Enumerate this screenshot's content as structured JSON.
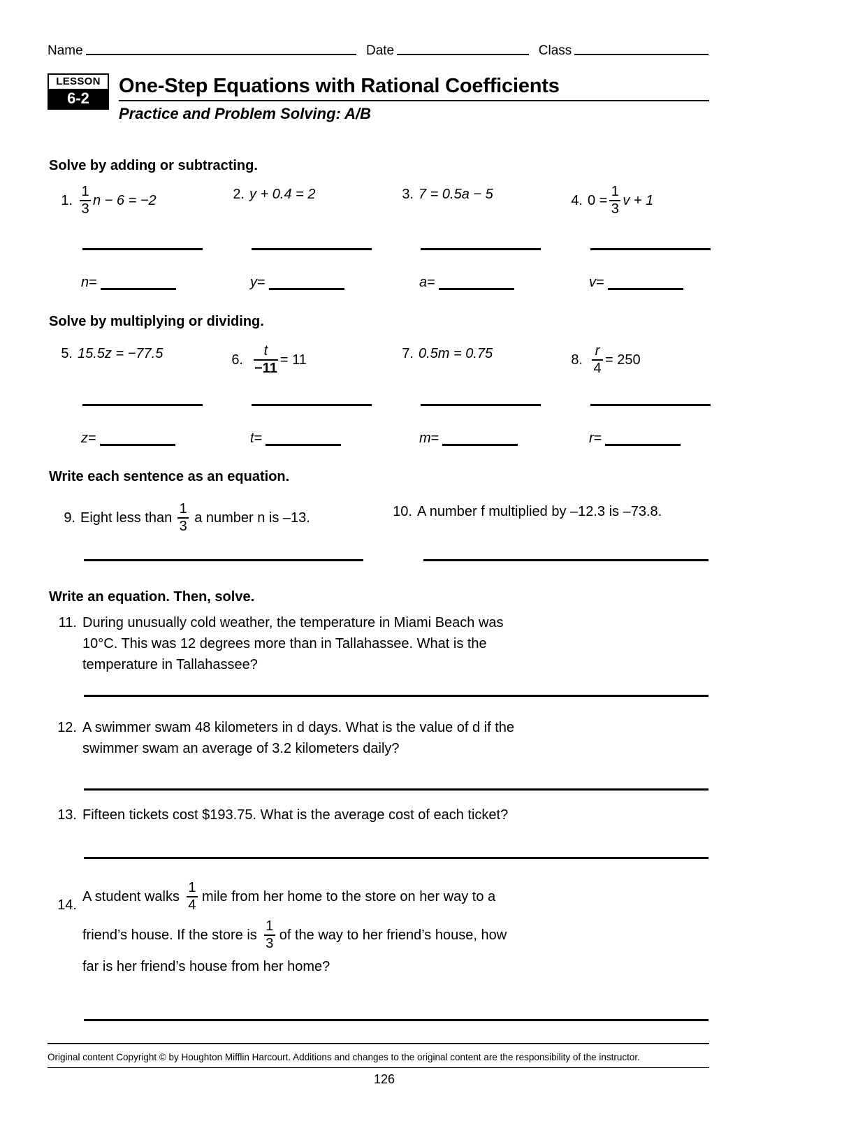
{
  "header": {
    "name_label": "Name",
    "date_label": "Date",
    "class_label": "Class"
  },
  "lesson_badge": {
    "word": "LESSON",
    "number": "6-2"
  },
  "title": "One-Step Equations with Rational Coefficients",
  "subtitle": "Practice and Problem Solving: A/B",
  "sections": {
    "add_subtract": "Solve by adding or subtracting.",
    "multiply_divide": "Solve by multiplying or dividing.",
    "write_sentence": "Write each sentence as an equation.",
    "write_solve": "Write an equation. Then, solve."
  },
  "problems_1_4": [
    {
      "number": "1.",
      "type": "fraction_lead",
      "frac": {
        "num": "1",
        "den": "3"
      },
      "after": "n − 6 = −2",
      "answer_var": "n",
      "equals": "="
    },
    {
      "number": "2.",
      "type": "plain",
      "text": "y + 0.4 = 2",
      "answer_var": "y",
      "equals": "="
    },
    {
      "number": "3.",
      "type": "plain",
      "text": "7 = 0.5a − 5",
      "answer_var": "a",
      "equals": "="
    },
    {
      "number": "4.",
      "type": "fraction_mid",
      "before": "0 =",
      "frac": {
        "num": "1",
        "den": "3"
      },
      "after": "v + 1",
      "answer_var": "v",
      "equals": "="
    }
  ],
  "problems_5_8": [
    {
      "number": "5.",
      "type": "plain",
      "text": "15.5z = −77.5",
      "answer_var": "z",
      "equals": "="
    },
    {
      "number": "6.",
      "type": "fraction_lead",
      "frac": {
        "num": "t",
        "den": "−11"
      },
      "after": "= 11",
      "answer_var": "t",
      "equals": "="
    },
    {
      "number": "7.",
      "type": "plain",
      "text": "0.5m = 0.75",
      "answer_var": "m",
      "equals": "="
    },
    {
      "number": "8.",
      "type": "fraction_lead",
      "frac": {
        "num": "r",
        "den": "4"
      },
      "after": "= 250",
      "answer_var": "r",
      "equals": "="
    }
  ],
  "problems_9_10": [
    {
      "number": "9.",
      "part1": "Eight less than",
      "frac": {
        "num": "1",
        "den": "3"
      },
      "part2": "a number n is –13."
    },
    {
      "number": "10.",
      "part1": "A number f multiplied by –12.3 is –73.8.",
      "frac": null,
      "part2": ""
    }
  ],
  "word_problems": [
    {
      "number": "11.",
      "lines": [
        "During unusually cold weather, the temperature in Miami Beach was",
        "10°C. This was 12 degrees more than in Tallahassee. What is the",
        "temperature in Tallahassee?"
      ]
    },
    {
      "number": "12.",
      "lines": [
        "A swimmer swam 48 kilometers in d days. What is the value of d if the",
        "swimmer swam an average of 3.2 kilometers daily?"
      ]
    },
    {
      "number": "13.",
      "lines": [
        "Fifteen tickets cost $193.75. What is the average cost of each ticket?"
      ]
    }
  ],
  "problem_14": {
    "number": "14.",
    "line1_a": "A student walks",
    "line1_frac": {
      "num": "1",
      "den": "4"
    },
    "line1_b": "mile from her home to the store on her way to a",
    "line2_a": "friend’s house. If the store is",
    "line2_frac": {
      "num": "1",
      "den": "3"
    },
    "line2_b": "of the way to her friend’s house, how",
    "line3": "far is her friend’s house from her home?"
  },
  "footer": {
    "copyright": "Original content Copyright © by Houghton Mifflin Harcourt. Additions and changes to the original content are the responsibility of the instructor.",
    "page_number": "126"
  }
}
